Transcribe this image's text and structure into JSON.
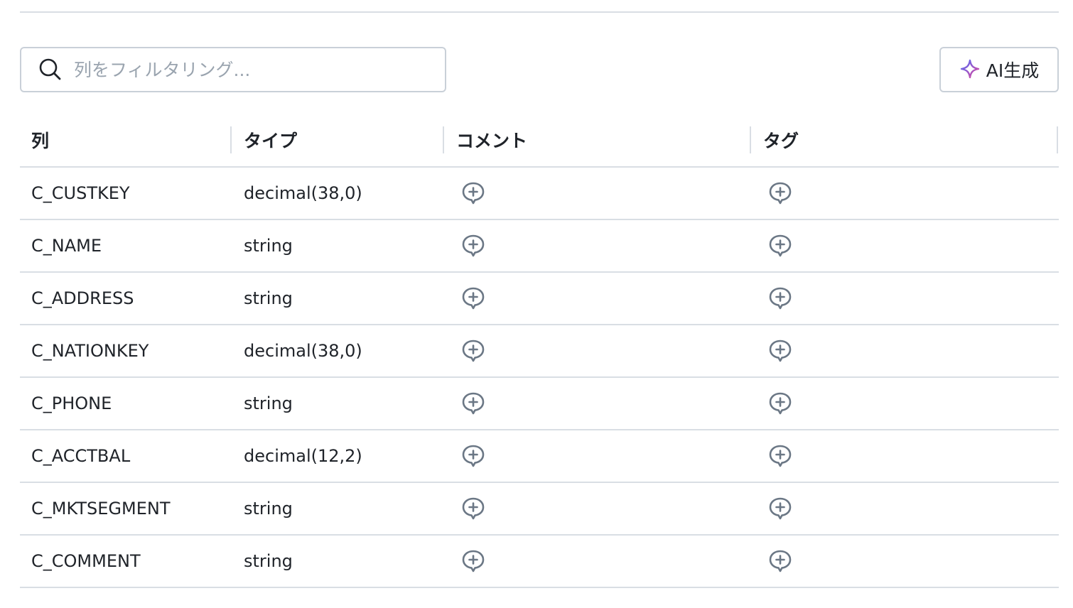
{
  "search": {
    "placeholder": "列をフィルタリング..."
  },
  "ai_button": {
    "label": "AI生成"
  },
  "table": {
    "headers": {
      "column": "列",
      "type": "タイプ",
      "comment": "コメント",
      "tag": "タグ"
    },
    "rows": [
      {
        "name": "C_CUSTKEY",
        "type": "decimal(38,0)"
      },
      {
        "name": "C_NAME",
        "type": "string"
      },
      {
        "name": "C_ADDRESS",
        "type": "string"
      },
      {
        "name": "C_NATIONKEY",
        "type": "decimal(38,0)"
      },
      {
        "name": "C_PHONE",
        "type": "string"
      },
      {
        "name": "C_ACCTBAL",
        "type": "decimal(12,2)"
      },
      {
        "name": "C_MKTSEGMENT",
        "type": "string"
      },
      {
        "name": "C_COMMENT",
        "type": "string"
      }
    ]
  },
  "icons": {
    "search": "search-icon",
    "ai": "sparkle-icon",
    "add_comment": "add-comment-icon",
    "add_tag": "add-tag-icon"
  },
  "colors": {
    "border": "#c9d0d8",
    "divider": "#d9dee4",
    "text": "#1f2329",
    "placeholder": "#9aa4af",
    "icon": "#6b7785",
    "sparkle_start": "#4f6cf7",
    "sparkle_end": "#e0479e"
  }
}
